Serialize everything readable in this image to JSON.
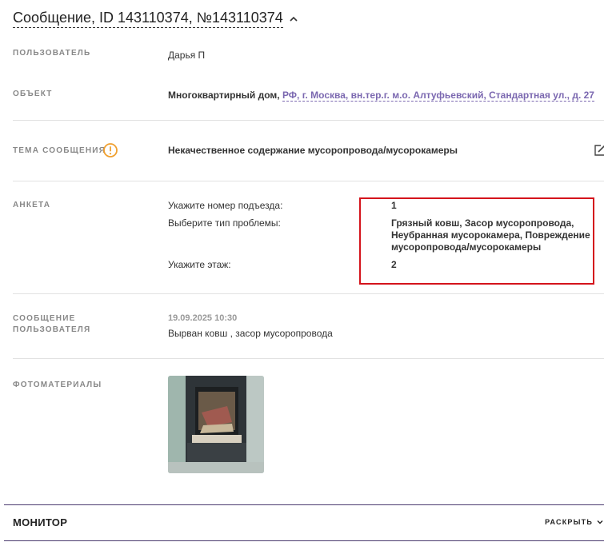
{
  "header": {
    "title": "Сообщение, ID 143110374, №143110374"
  },
  "user": {
    "label": "ПОЛЬЗОВАТЕЛЬ",
    "value": "Дарья П"
  },
  "object": {
    "label": "ОБЪЕКТ",
    "type": "Многоквартирный дом,",
    "address": "РФ, г. Москва, вн.тер.г. м.о. Алтуфьевский, Стандартная ул., д. 27"
  },
  "topic": {
    "label": "ТЕМА СООБЩЕНИЯ",
    "value": "Некачественное содержание мусоропровода/мусорокамеры"
  },
  "survey": {
    "label": "АНКЕТА",
    "items": [
      {
        "question": "Укажите номер подъезда:",
        "answer": "1"
      },
      {
        "question": "Выберите тип проблемы:",
        "answer": "Грязный ковш, Засор мусоропровода, Неубранная мусорокамера, Повреждение мусоропровода/мусорокамеры"
      },
      {
        "question": "Укажите этаж:",
        "answer": "2"
      }
    ]
  },
  "message": {
    "label_line1": "СООБЩЕНИЕ",
    "label_line2": "ПОЛЬЗОВАТЕЛЯ",
    "date": "19.09.2025 10:30",
    "text": "Вырван ковш , засор мусоропровода"
  },
  "photos": {
    "label": "ФОТОМАТЕРИАЛЫ"
  },
  "monitor": {
    "title": "МОНИТОР",
    "expand_label": "РАСКРЫТЬ"
  },
  "colors": {
    "accent": "#7b68b0",
    "warning": "#f0a030",
    "highlight_box": "#d4141c",
    "monitor_line": "#4a3a6e"
  }
}
